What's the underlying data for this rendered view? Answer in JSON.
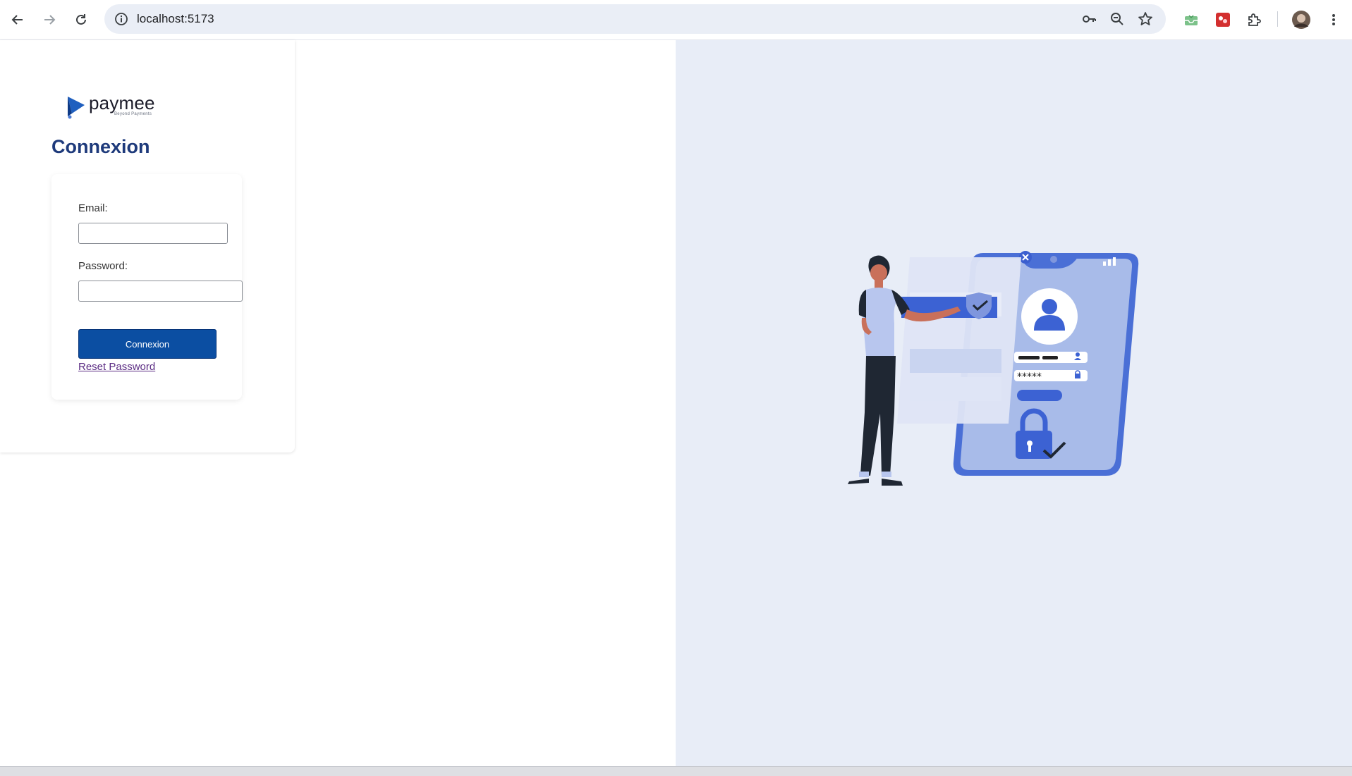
{
  "browser": {
    "url": "localhost:5173",
    "icons": {
      "back": "back-arrow-icon",
      "forward": "forward-arrow-icon",
      "reload": "reload-icon",
      "site_info": "info-icon",
      "password": "key-icon",
      "zoom": "zoom-icon",
      "bookmark": "star-icon",
      "extensions": "puzzle-icon",
      "menu": "more-vert-icon"
    }
  },
  "login": {
    "logo_text": "paymee",
    "logo_tagline": "Beyond Payments",
    "title": "Connexion",
    "email_label": "Email:",
    "email_value": "",
    "password_label": "Password:",
    "password_value": "",
    "submit_label": "Connexion",
    "reset_link": "Reset Password"
  },
  "theme": {
    "primary": "#0b4ea2",
    "title_color": "#1e3a7b",
    "link_color": "#5b2c83",
    "right_panel_bg": "#e8edf7"
  }
}
